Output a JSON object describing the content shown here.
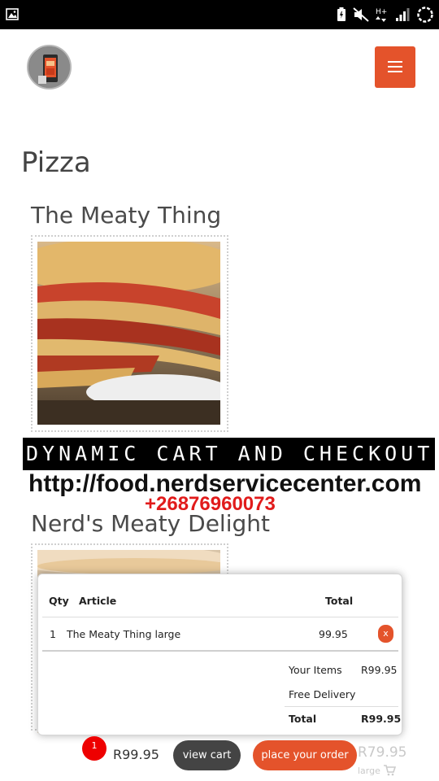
{
  "status_bar": {
    "icons": [
      "image-icon",
      "battery-icon",
      "mute-icon",
      "network-type-icon",
      "signal-icon",
      "loading-icon"
    ],
    "network_label": "H+"
  },
  "header": {
    "logo": "logo-icon",
    "menu_icon": "hamburger-icon",
    "accent_color": "#e4532b"
  },
  "main": {
    "category_title": "Pizza",
    "products": [
      {
        "name": "The Meaty Thing"
      },
      {
        "name": "Nerd's Meaty Delight"
      }
    ]
  },
  "overlay": {
    "banner": "DYNAMIC CART AND CHECKOUT",
    "url": "http://food.nerdservicecenter.com",
    "phone": "+26876960073"
  },
  "cart": {
    "columns": {
      "qty": "Qty",
      "article": "Article",
      "total": "Total"
    },
    "items": [
      {
        "qty": "1",
        "article": "The Meaty Thing large",
        "total": "99.95",
        "remove": "x"
      }
    ],
    "summary": {
      "your_items_label": "Your Items",
      "your_items_value": "R99.95",
      "delivery_label": "Free Delivery",
      "total_label": "Total",
      "total_value": "R99.95"
    }
  },
  "bottom_bar": {
    "count": "1",
    "total": "R99.95",
    "view_cart": "view cart",
    "place_order": "place your order",
    "bg_price": "R79.95",
    "bg_size": "large"
  }
}
